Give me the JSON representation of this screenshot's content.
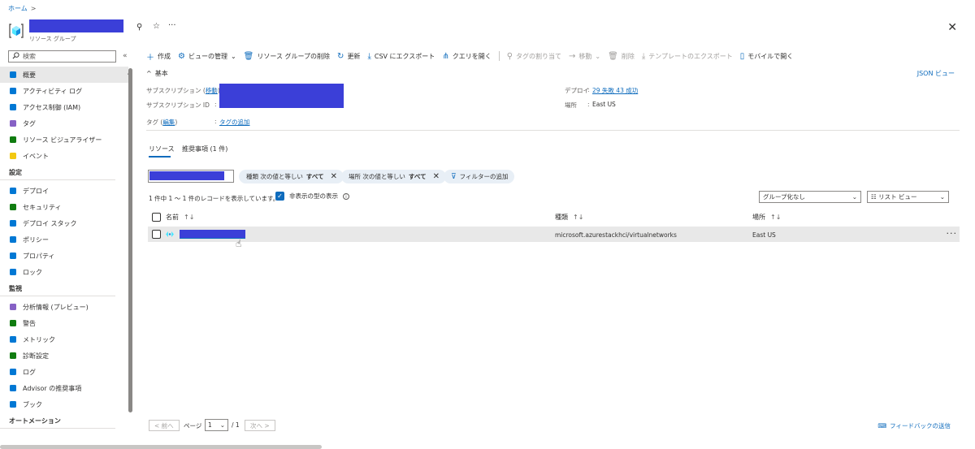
{
  "breadcrumb": {
    "home": "ホーム",
    "sep": ">"
  },
  "header": {
    "subtitle": "リソース グループ",
    "pin": "⚲",
    "star": "☆",
    "ellipsis": "···",
    "close": "✕",
    "icon": "resource-group-icon"
  },
  "search": {
    "placeholder": "検索",
    "icon": "search-icon",
    "collapse": "«"
  },
  "sidebar": {
    "top_items": [
      {
        "label": "概要",
        "icon": "overview-icon",
        "color": "#0078d4",
        "selected": true
      },
      {
        "label": "アクティビティ ログ",
        "icon": "activity-log-icon",
        "color": "#0078d4"
      },
      {
        "label": "アクセス制御 (IAM)",
        "icon": "iam-icon",
        "color": "#0078d4"
      },
      {
        "label": "タグ",
        "icon": "tag-icon",
        "color": "#8661c5"
      },
      {
        "label": "リソース ビジュアライザー",
        "icon": "visualizer-icon",
        "color": "#107c10"
      },
      {
        "label": "イベント",
        "icon": "lightning-icon",
        "color": "#f2c811"
      }
    ],
    "settings_title": "設定",
    "settings_items": [
      {
        "label": "デプロイ",
        "icon": "deploy-icon",
        "color": "#0078d4"
      },
      {
        "label": "セキュリティ",
        "icon": "shield-icon",
        "color": "#107c10"
      },
      {
        "label": "デプロイ スタック",
        "icon": "deploy-stack-icon",
        "color": "#0078d4"
      },
      {
        "label": "ポリシー",
        "icon": "policy-icon",
        "color": "#0078d4"
      },
      {
        "label": "プロパティ",
        "icon": "properties-icon",
        "color": "#0078d4"
      },
      {
        "label": "ロック",
        "icon": "lock-icon",
        "color": "#0078d4"
      }
    ],
    "monitor_title": "監視",
    "monitor_items": [
      {
        "label": "分析情報 (プレビュー)",
        "icon": "insights-icon",
        "color": "#8661c5"
      },
      {
        "label": "警告",
        "icon": "alert-icon",
        "color": "#107c10"
      },
      {
        "label": "メトリック",
        "icon": "metrics-icon",
        "color": "#0078d4"
      },
      {
        "label": "診断設定",
        "icon": "diagnostics-icon",
        "color": "#107c10"
      },
      {
        "label": "ログ",
        "icon": "logs-icon",
        "color": "#0078d4"
      },
      {
        "label": "Advisor の推奨事項",
        "icon": "advisor-icon",
        "color": "#0078d4"
      },
      {
        "label": "ブック",
        "icon": "workbook-icon",
        "color": "#0078d4"
      }
    ],
    "automation_title": "オートメーション"
  },
  "toolbar": [
    {
      "label": "作成",
      "icon": "＋",
      "disabled": false
    },
    {
      "label": "ビューの管理",
      "icon": "⚙",
      "disabled": false,
      "caret": true
    },
    {
      "label": "リソース グループの削除",
      "icon": "🗑",
      "disabled": false
    },
    {
      "label": "更新",
      "icon": "↻",
      "disabled": false
    },
    {
      "label": "CSV にエクスポート",
      "icon": "⤓",
      "disabled": false
    },
    {
      "label": "クエリを開く",
      "icon": "⋔",
      "disabled": false
    },
    {
      "label": "タグの割り当て",
      "icon": "⚲",
      "disabled": true
    },
    {
      "label": "移動",
      "icon": "→",
      "disabled": true,
      "caret": true
    },
    {
      "label": "削除",
      "icon": "🗑",
      "disabled": true
    },
    {
      "label": "テンプレートのエクスポート",
      "icon": "⤓",
      "disabled": true
    },
    {
      "label": "モバイルで開く",
      "icon": "▯",
      "disabled": false
    }
  ],
  "essentials": {
    "title": "基本",
    "json_view": "JSON ビュー",
    "subscription_label": "サブスクリプション",
    "subscription_move": "移動",
    "subscription_id_label": "サブスクリプション ID",
    "tags_label": "タグ",
    "tags_edit": "編集",
    "tags_add": "タグの追加",
    "deploy_label": "デプロイ",
    "deploy_value": "29 失敗 43 成功",
    "location_label": "場所",
    "location_value": "East US",
    "colon": ":"
  },
  "tabs": {
    "resources": "リソース",
    "recommendations": "推奨事項 (1 件)"
  },
  "filters": {
    "type_pill": {
      "prefix": "種類 次の値と等しい",
      "value": "すべて"
    },
    "location_pill": {
      "prefix": "場所 次の値と等しい",
      "value": "すべて"
    },
    "add_filter": "フィルターの追加"
  },
  "records_text": "1 件中 1 ～ 1 件のレコードを表示しています。",
  "show_hidden": "非表示の型の表示",
  "group_by": "グループ化なし",
  "list_view": "☷ リスト ビュー",
  "table": {
    "headers": {
      "name": "名前",
      "type": "種類",
      "location": "場所"
    },
    "rows": [
      {
        "type": "microsoft.azurestackhci/virtualnetworks",
        "location": "East US"
      }
    ]
  },
  "pager": {
    "prev": "< 前へ",
    "page_label": "ページ",
    "page_value": "1",
    "of": "/ 1",
    "next": "次へ >"
  },
  "feedback": "フィードバックの送信"
}
